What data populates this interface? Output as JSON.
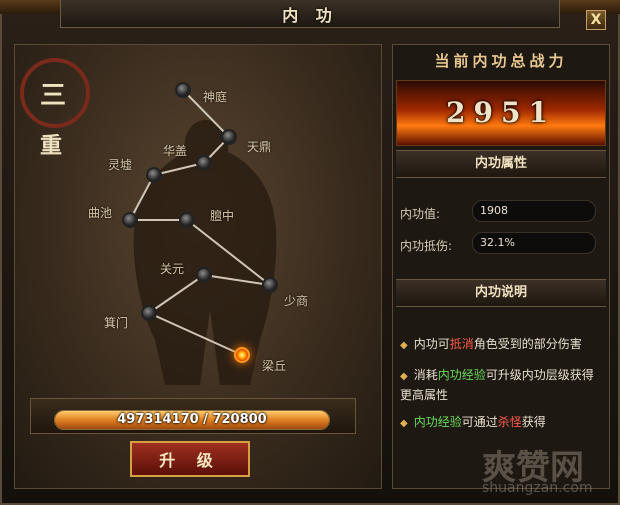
{
  "window": {
    "title": "内 功",
    "close_label": "X"
  },
  "rank": {
    "level_char": "三",
    "suffix_char": "重"
  },
  "acupoints": [
    {
      "name": "神庭",
      "active": false
    },
    {
      "name": "天鼎",
      "active": false
    },
    {
      "name": "华盖",
      "active": false
    },
    {
      "name": "灵墟",
      "active": false
    },
    {
      "name": "曲池",
      "active": false
    },
    {
      "name": "膻中",
      "active": false
    },
    {
      "name": "关元",
      "active": false
    },
    {
      "name": "少商",
      "active": false
    },
    {
      "name": "箕门",
      "active": false
    },
    {
      "name": "梁丘",
      "active": true
    }
  ],
  "experience": {
    "current": "497314170",
    "separator": "/",
    "max": "720800",
    "text": "497314170 / 720800",
    "fill_fraction": 1.0
  },
  "upgrade_button": {
    "label": "升 级"
  },
  "power": {
    "title": "当前内功总战力",
    "value": "2951"
  },
  "attributes": {
    "header": "内功属性",
    "items": [
      {
        "label": "内功值:",
        "value": "1908"
      },
      {
        "label": "内功抵伤:",
        "value": "32.1%"
      }
    ]
  },
  "description": {
    "header": "内功说明",
    "line1": {
      "pre": "内功可",
      "hl": "抵消",
      "post": "角色受到的部分伤害"
    },
    "line2": {
      "pre": "消耗",
      "hl": "内功经验",
      "post": "可升级内功层级获得更高属性"
    },
    "line3": {
      "hl": "内功经验",
      "mid": "可通过",
      "hl2": "杀怪",
      "post": "获得"
    }
  },
  "watermark": {
    "text": "爽赞网",
    "url": "shuangzan.com"
  },
  "colors": {
    "accent_gold": "#d4a040",
    "fire": "#ff7a10",
    "highlight_red": "#ff5a4a",
    "highlight_green": "#6adc5a"
  }
}
